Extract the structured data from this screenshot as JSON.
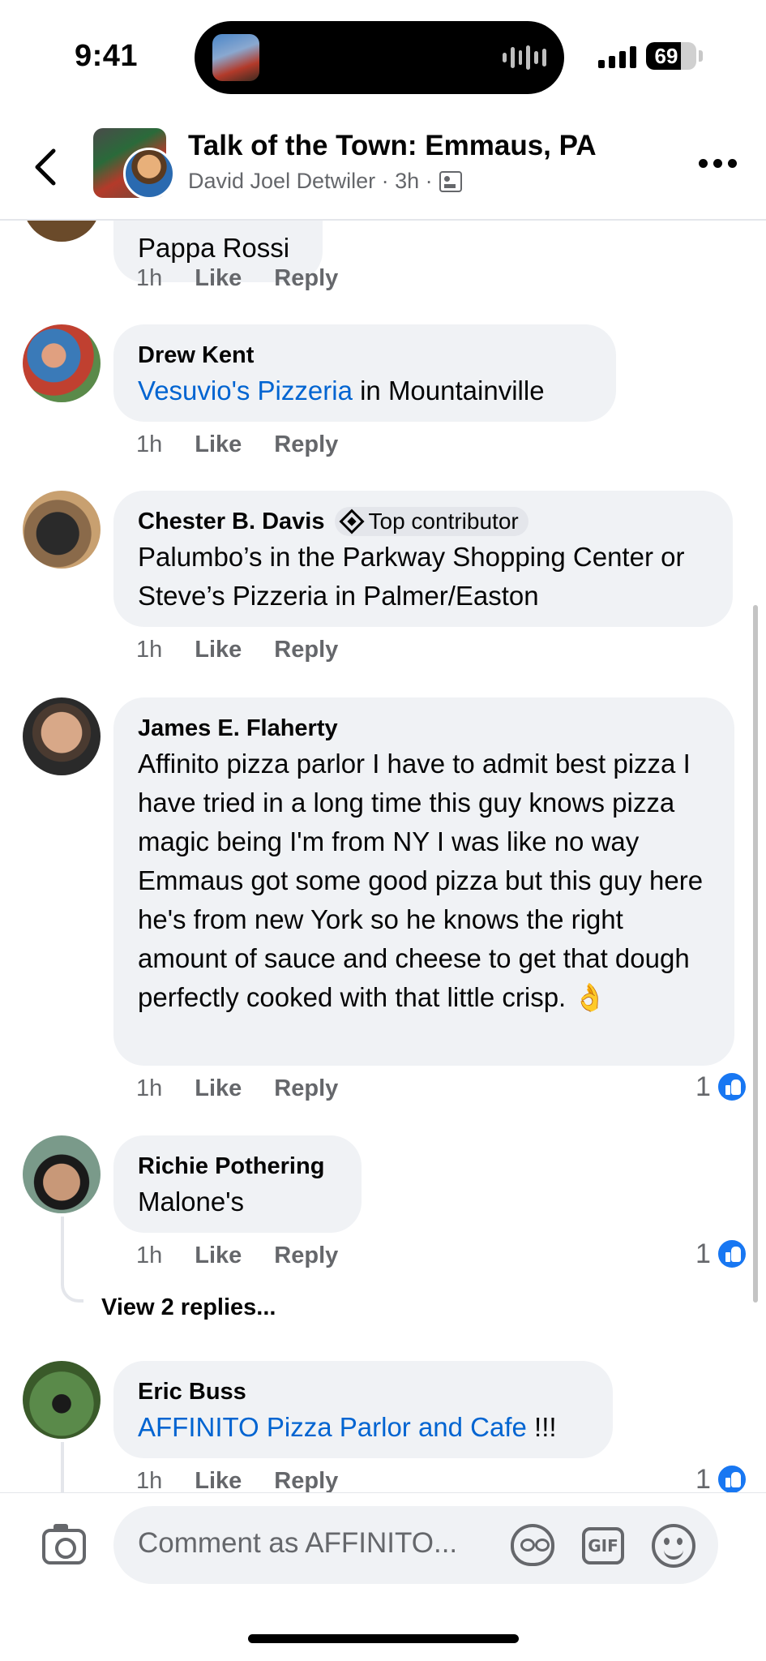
{
  "status_bar": {
    "time": "9:41",
    "battery": "69",
    "battery_level": 0.69
  },
  "header": {
    "title": "Talk of the Town: Emmaus, PA",
    "subtitle": "David Joel Detwiler · 3h ·"
  },
  "comments": [
    {
      "author": "",
      "text": "Pappa Rossi",
      "time": "1h",
      "like_label": "Like",
      "reply_label": "Reply"
    },
    {
      "author": "Drew Kent",
      "link_text": "Vesuvio's Pizzeria",
      "text_after_link": " in Mountainville",
      "time": "1h",
      "like_label": "Like",
      "reply_label": "Reply"
    },
    {
      "author": "Chester B. Davis",
      "badge": "Top contributor",
      "text": "Palumbo’s in the Parkway Shopping Center or Steve’s Pizzeria in Palmer/Easton",
      "time": "1h",
      "like_label": "Like",
      "reply_label": "Reply"
    },
    {
      "author": "James E. Flaherty",
      "text": "Affinito pizza parlor I have to admit best pizza I have tried in a long time this guy knows pizza magic being I'm from NY I was like no way Emmaus got some good pizza but this guy here he's from new York so he knows the right amount of sauce and cheese to get that dough perfectly cooked with that little crisp. 👌",
      "time": "1h",
      "like_label": "Like",
      "reply_label": "Reply",
      "reaction_count": "1"
    },
    {
      "author": "Richie Pothering",
      "text": "Malone's",
      "time": "1h",
      "like_label": "Like",
      "reply_label": "Reply",
      "reaction_count": "1",
      "view_replies": "View 2 replies..."
    },
    {
      "author": "Eric Buss",
      "link_text": "AFFINITO Pizza Parlor and Cafe",
      "text_after_link": " !!!",
      "time": "1h",
      "like_label": "Like",
      "reply_label": "Reply",
      "reaction_count": "1"
    }
  ],
  "composer": {
    "placeholder": "Comment as AFFINITO..."
  },
  "colors": {
    "link": "#0064d1",
    "like_blue": "#1877f2",
    "bubble": "#f0f2f5",
    "meta_gray": "#65676b"
  },
  "icons": [
    "back-chevron-icon",
    "more-icon",
    "audience-icon",
    "top-contributor-icon",
    "like-reaction-icon",
    "camera-icon",
    "avatar-sticker-icon",
    "gif-icon",
    "emoji-icon"
  ]
}
